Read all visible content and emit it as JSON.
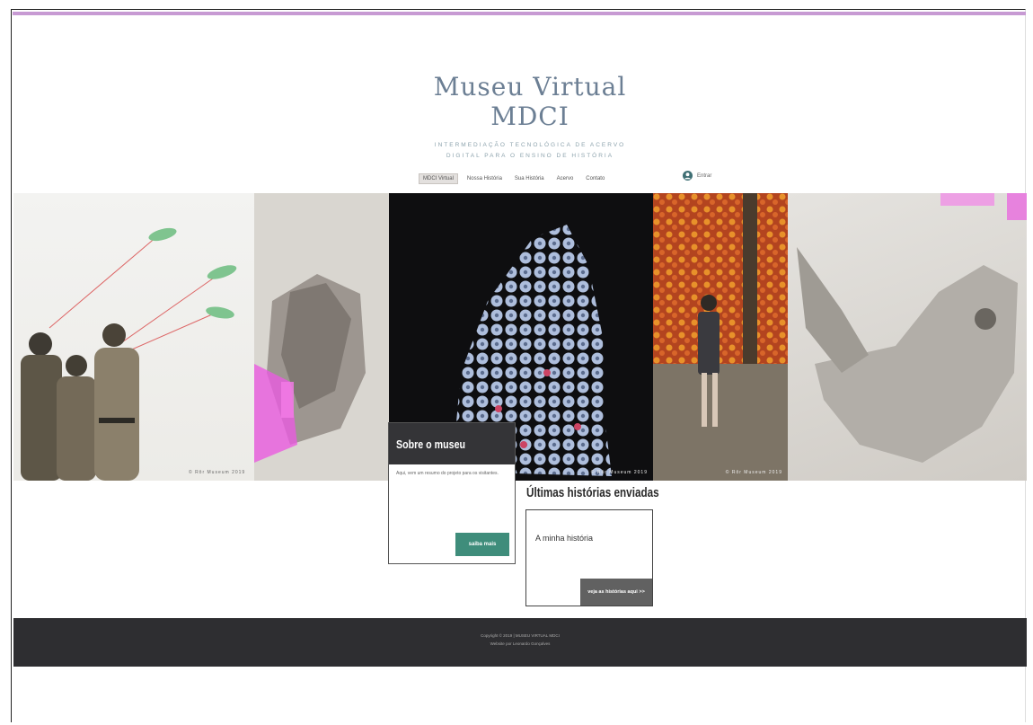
{
  "brand": {
    "title": "Museu Virtual MDCI",
    "tagline_line1": "INTERMEDIAÇÃO TECNOLÓGICA DE ACERVO",
    "tagline_line2": "DIGITAL PARA O ENSINO DE HISTÓRIA"
  },
  "nav": {
    "items": [
      "MDCI Virtual",
      "Nossa História",
      "Sua História",
      "Acervo",
      "Contato"
    ],
    "active_index": 0
  },
  "login": {
    "label": "Entrar"
  },
  "gallery": {
    "credits": [
      "© Rôr Museum 2019",
      "© Rôr Museum 2019",
      "© Rôr Museum 2019"
    ]
  },
  "about": {
    "title": "Sobre o museu",
    "text": "Aqui, vem um resumo do projeto para os visitantes.",
    "button": "saiba mais"
  },
  "stories": {
    "title": "Últimas histórias enviadas",
    "item_title": "A minha história",
    "button": "veja as histórias aqui >>"
  },
  "footer": {
    "line1": "Copyright © 2019 | MUSEU VIRTUAL MDCI",
    "line2": "Website por Leonardo Gonçalves"
  },
  "colors": {
    "accent_bar": "#c79ad3",
    "brand_text": "#6c7f94",
    "about_button": "#3f8d7b",
    "story_button": "#616161",
    "footer_bg": "#2e2e31"
  }
}
